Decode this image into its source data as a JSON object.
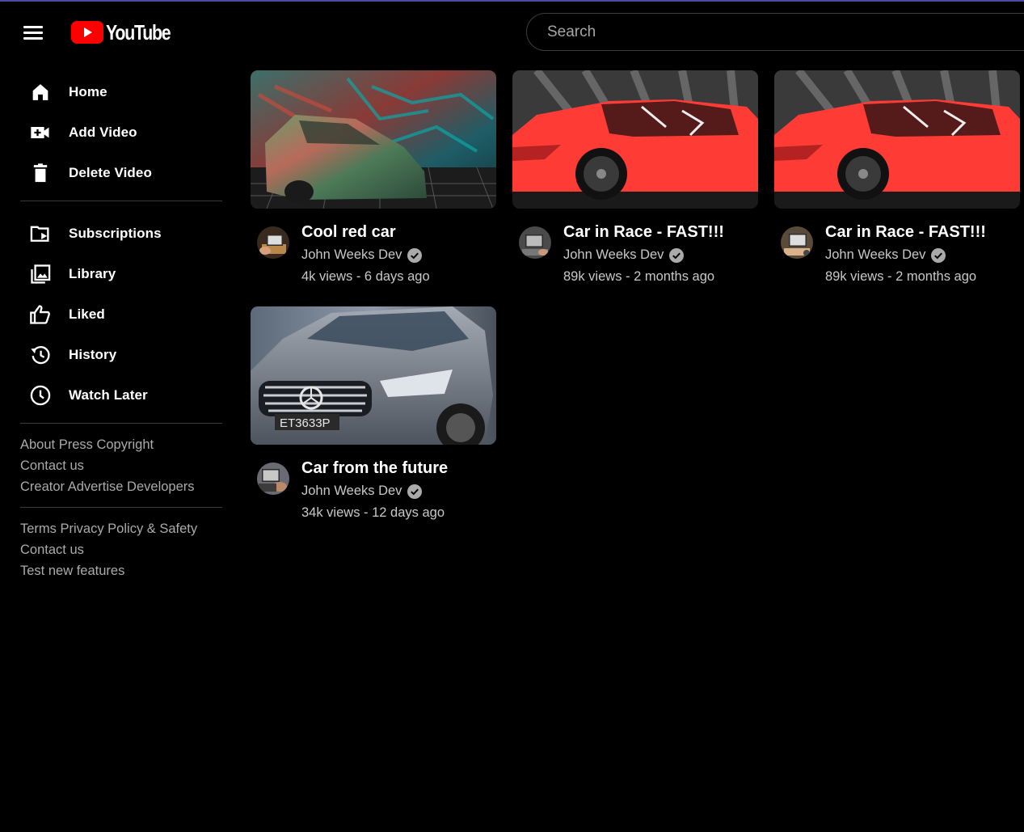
{
  "header": {
    "logo_text": "YouTube",
    "search_placeholder": "Search"
  },
  "sidebar": {
    "primary": [
      {
        "label": "Home",
        "icon": "home-icon"
      },
      {
        "label": "Add Video",
        "icon": "add-video-icon"
      },
      {
        "label": "Delete Video",
        "icon": "trash-icon"
      }
    ],
    "secondary": [
      {
        "label": "Subscriptions",
        "icon": "subscriptions-icon"
      },
      {
        "label": "Library",
        "icon": "library-icon"
      },
      {
        "label": "Liked",
        "icon": "thumbs-up-icon"
      },
      {
        "label": "History",
        "icon": "history-icon"
      },
      {
        "label": "Watch Later",
        "icon": "clock-icon"
      }
    ],
    "footer1": [
      "About Press Copyright",
      "Contact us",
      "Creator Advertise Developers"
    ],
    "footer2": [
      "Terms Privacy Policy & Safety",
      "Contact us",
      "Test new features"
    ]
  },
  "videos": [
    {
      "title": "Cool red car",
      "channel": "John Weeks Dev",
      "stats": "4k views - 6 days ago"
    },
    {
      "title": "Car in Race - FAST!!!",
      "channel": "John Weeks Dev",
      "stats": "89k views - 2 months ago"
    },
    {
      "title": "Car in Race - FAST!!!",
      "channel": "John Weeks Dev",
      "stats": "89k views - 2 months ago"
    },
    {
      "title": "Car from the future",
      "channel": "John Weeks Dev",
      "stats": "34k views - 12 days ago",
      "plate": "ET3633P"
    }
  ],
  "colors": {
    "brand_red": "#ff0000",
    "background": "#000000",
    "secondary_text": "#aaaaaa",
    "verified_badge": "#aaaaaa"
  }
}
